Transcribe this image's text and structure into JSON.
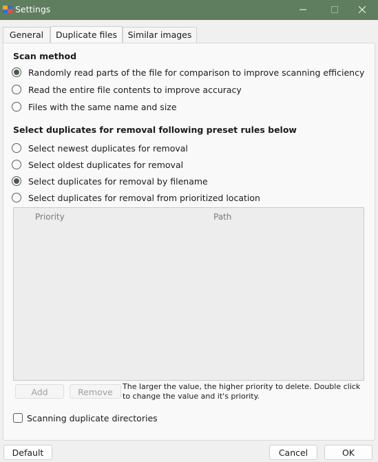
{
  "window": {
    "title": "Settings"
  },
  "icons": {
    "app": "app-logo-icon",
    "minimize": "minimize-icon",
    "maximize": "maximize-icon",
    "close": "close-icon"
  },
  "tabs": [
    {
      "label": "General",
      "active": false
    },
    {
      "label": "Duplicate files",
      "active": true
    },
    {
      "label": "Similar images",
      "active": false
    }
  ],
  "scan_method": {
    "heading": "Scan method",
    "options": [
      {
        "label": "Randomly read parts of the file for comparison to improve scanning efficiency",
        "checked": true
      },
      {
        "label": "Read the entire file contents to improve accuracy",
        "checked": false
      },
      {
        "label": "Files with the same name and size",
        "checked": false
      }
    ]
  },
  "removal_rules": {
    "heading": "Select duplicates for removal following preset rules below",
    "options": [
      {
        "label": "Select newest duplicates for removal",
        "checked": false
      },
      {
        "label": "Select oldest duplicates for removal",
        "checked": false
      },
      {
        "label": "Select duplicates for removal by filename",
        "checked": true
      },
      {
        "label": "Select duplicates for removal from prioritized location",
        "checked": false
      }
    ]
  },
  "priority_table": {
    "columns": [
      "Priority",
      "Path"
    ],
    "rows": []
  },
  "buttons": {
    "add": "Add",
    "remove": "Remove",
    "default": "Default",
    "cancel": "Cancel",
    "ok": "OK"
  },
  "hint": "The larger the value, the higher priority to delete. Double click to change the value and it's priority.",
  "scan_dirs": {
    "label": "Scanning duplicate directories",
    "checked": false
  }
}
